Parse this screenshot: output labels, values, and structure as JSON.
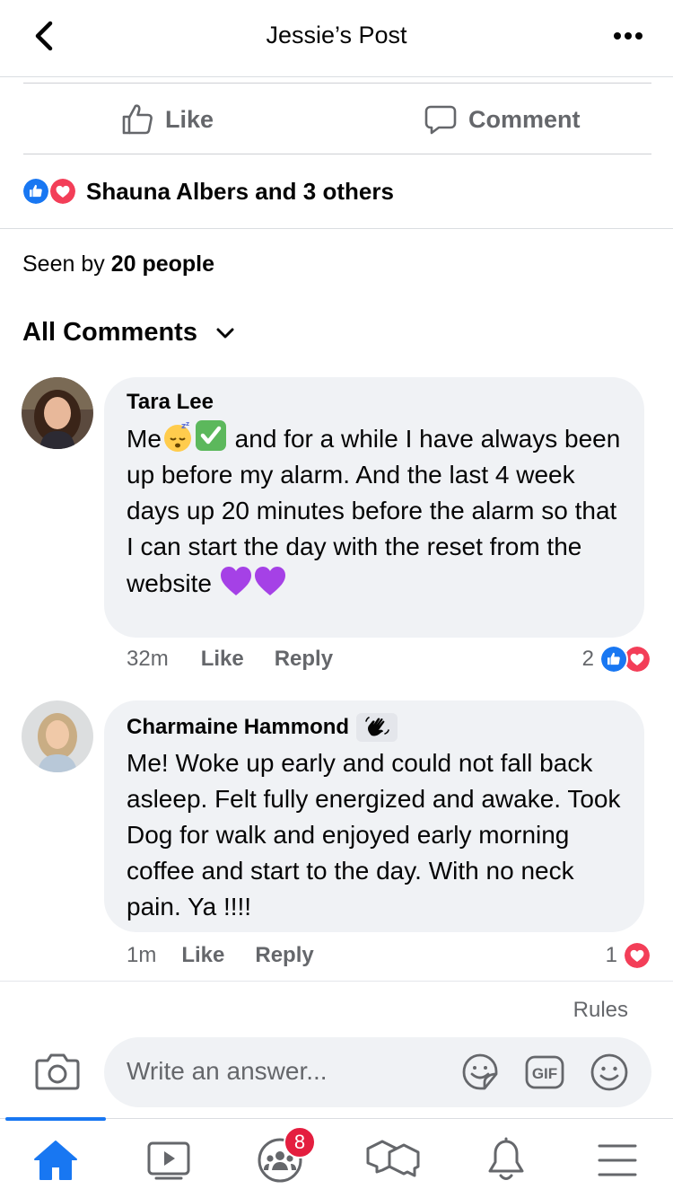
{
  "header": {
    "title": "Jessie’s Post"
  },
  "actions": {
    "like_label": "Like",
    "comment_label": "Comment"
  },
  "reactions": {
    "summary": "Shauna Albers and 3 others"
  },
  "seen": {
    "prefix": "Seen by ",
    "count_text": "20 people"
  },
  "comments_header": {
    "label": "All Comments"
  },
  "comments": [
    {
      "name": "Tara Lee",
      "text_1": "Me",
      "text_2": " and for a while I have always been up before my alarm. And the last 4 week days up 20 minutes before the alarm so that I can start the day with the reset from the website ",
      "time": "32m",
      "like_label": "Like",
      "reply_label": "Reply",
      "reaction_count": "2"
    },
    {
      "name": "Charmaine Hammond",
      "text": "Me! Woke up early and could not fall back asleep. Felt fully energized and awake. Took Dog for walk and enjoyed early morning coffee and start to the day. With no neck pain. Ya !!!!",
      "time": "1m",
      "like_label": "Like",
      "reply_label": "Reply",
      "reaction_count": "1"
    }
  ],
  "composer": {
    "rules_label": "Rules",
    "placeholder": "Write an answer..."
  },
  "tabbar": {
    "groups_badge": "8"
  },
  "colors": {
    "accent": "#1877f2",
    "love": "#f33e58",
    "bubble": "#f0f2f5",
    "muted": "#65676b",
    "badge": "#e41e3f"
  }
}
